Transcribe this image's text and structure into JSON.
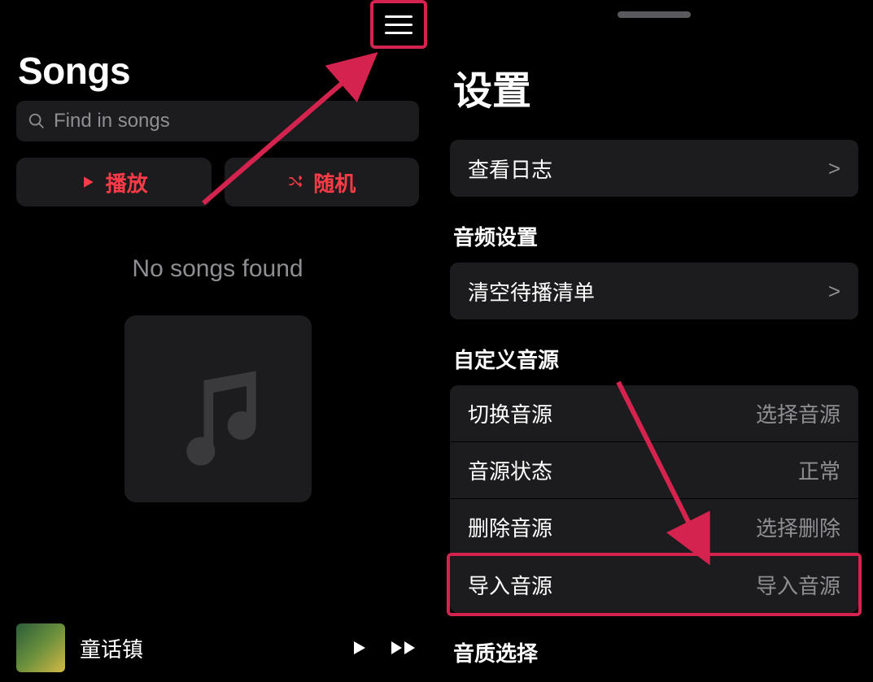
{
  "left": {
    "title": "Songs",
    "search_placeholder": "Find in songs",
    "play_label": "播放",
    "shuffle_label": "随机",
    "empty_text": "No songs found",
    "nowplaying_title": "童话镇"
  },
  "right": {
    "title": "设置",
    "view_log": {
      "label": "查看日志",
      "chevron": ">"
    },
    "audio_section": "音频设置",
    "clear_queue": {
      "label": "清空待播清单",
      "chevron": ">"
    },
    "custom_source_section": "自定义音源",
    "switch_source": {
      "label": "切换音源",
      "value": "选择音源"
    },
    "source_status": {
      "label": "音源状态",
      "value": "正常"
    },
    "delete_source": {
      "label": "删除音源",
      "value": "选择删除"
    },
    "import_source": {
      "label": "导入音源",
      "value": "导入音源"
    },
    "quality_section": "音质选择"
  }
}
